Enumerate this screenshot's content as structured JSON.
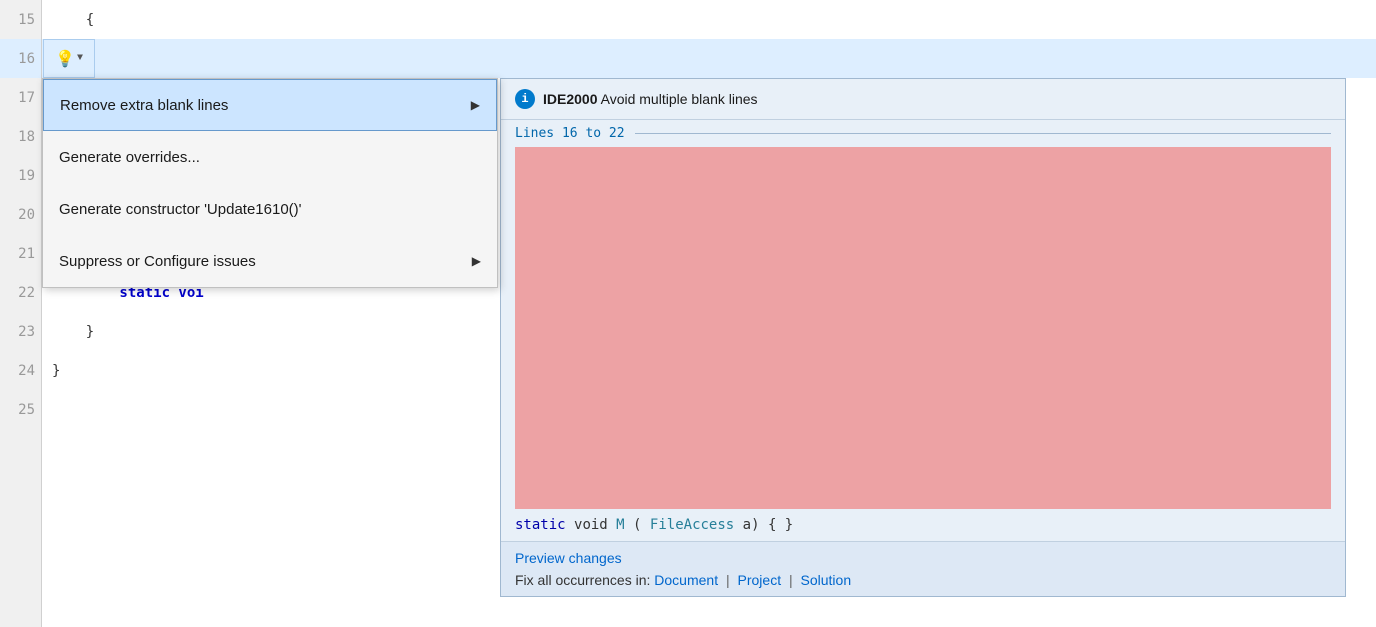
{
  "editor": {
    "background": "#ffffff",
    "lines": [
      {
        "number": "15",
        "content": "    {",
        "indent": 4
      },
      {
        "number": "16",
        "content": "",
        "highlighted": true
      },
      {
        "number": "17",
        "content": "",
        "indent": 0
      },
      {
        "number": "18",
        "content": "",
        "indent": 0
      },
      {
        "number": "19",
        "content": "",
        "indent": 0
      },
      {
        "number": "20",
        "content": "",
        "indent": 0
      },
      {
        "number": "21",
        "content": "",
        "indent": 0
      },
      {
        "number": "22",
        "content": "        static voi",
        "indent": 8
      },
      {
        "number": "23",
        "content": "    }",
        "indent": 4
      },
      {
        "number": "24",
        "content": "}",
        "indent": 0
      },
      {
        "number": "25",
        "content": "",
        "indent": 0
      }
    ]
  },
  "lightbulb": {
    "icon": "💡",
    "arrow": "▼"
  },
  "context_menu": {
    "items": [
      {
        "id": "remove-blank-lines",
        "label": "Remove extra blank lines",
        "has_submenu": true,
        "selected": true
      },
      {
        "id": "generate-overrides",
        "label": "Generate overrides...",
        "has_submenu": false,
        "selected": false
      },
      {
        "id": "generate-constructor",
        "label": "Generate constructor 'Update1610()'",
        "has_submenu": false,
        "selected": false
      },
      {
        "id": "suppress-configure",
        "label": "Suppress or Configure issues",
        "has_submenu": true,
        "selected": false
      }
    ]
  },
  "preview_panel": {
    "info_icon": "i",
    "issue_id": "IDE2000",
    "issue_title": "Avoid multiple blank lines",
    "lines_range": "Lines 16 to 22",
    "preview_code": "static void M(FileAccess a) { }",
    "preview_changes_label": "Preview changes",
    "fix_label": "Fix all occurrences in:",
    "fix_links": [
      {
        "id": "document-link",
        "label": "Document"
      },
      {
        "id": "project-link",
        "label": "Project"
      },
      {
        "id": "solution-link",
        "label": "Solution"
      }
    ]
  }
}
